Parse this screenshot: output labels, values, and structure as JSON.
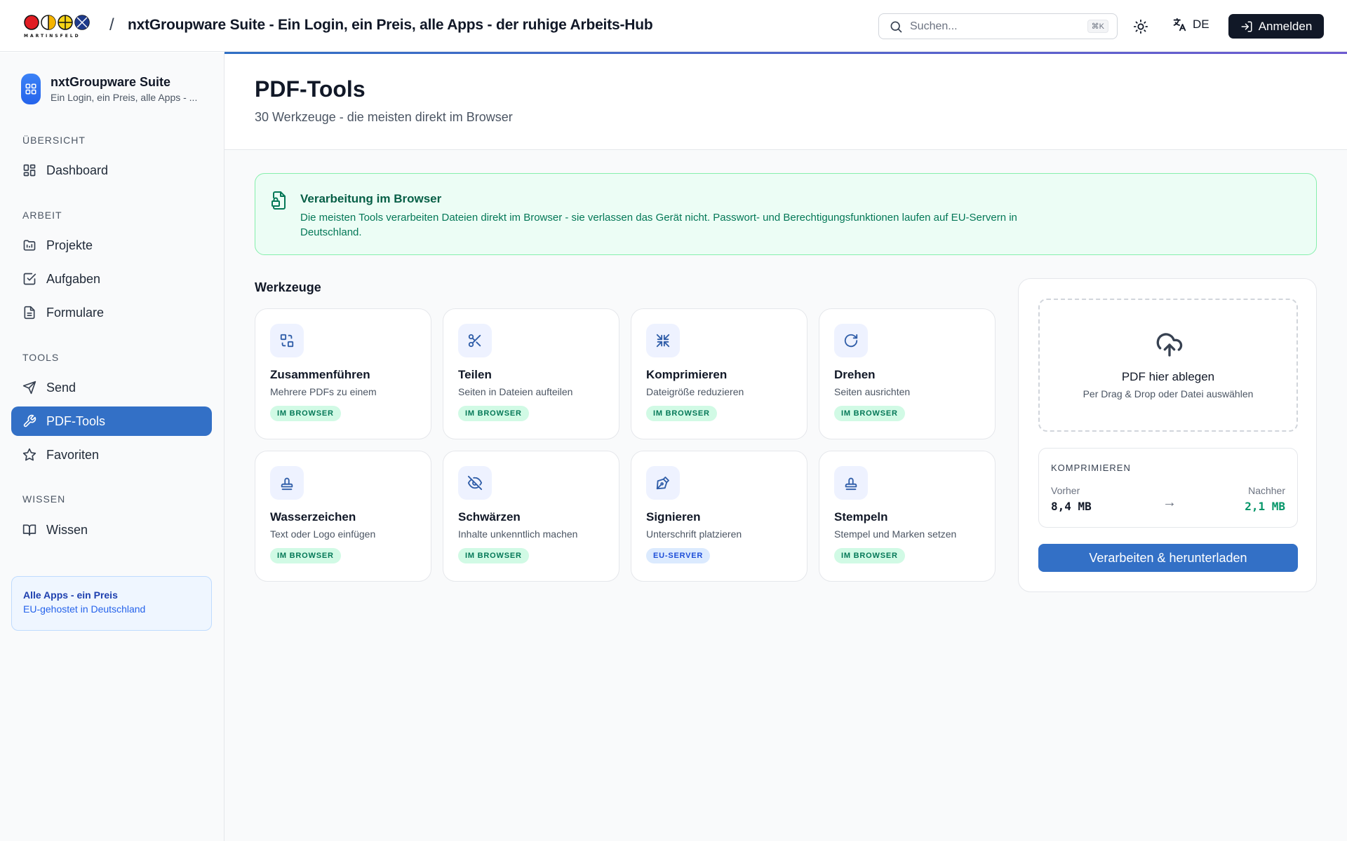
{
  "topbar": {
    "logo_text": "MARTINSFELD",
    "separator": "/",
    "title": "nxtGroupware Suite - Ein Login, ein Preis, alle Apps - der ruhige Arbeits-Hub",
    "search_placeholder": "Suchen...",
    "search_shortcut": "⌘K",
    "language": "DE",
    "login_label": "Anmelden"
  },
  "sidebar": {
    "app_name": "nxtGroupware Suite",
    "app_sub": "Ein Login, ein Preis, alle Apps - ...",
    "sections": {
      "overview": "ÜBERSICHT",
      "work": "ARBEIT",
      "tools": "TOOLS",
      "knowledge": "WISSEN"
    },
    "items": {
      "dashboard": "Dashboard",
      "projects": "Projekte",
      "tasks": "Aufgaben",
      "forms": "Formulare",
      "send": "Send",
      "pdf_tools": "PDF-Tools",
      "favorites": "Favoriten",
      "knowledge": "Wissen"
    },
    "active_item": "pdf_tools",
    "promo": {
      "title": "Alle Apps - ein Preis",
      "sub": "EU-gehostet in Deutschland"
    }
  },
  "page": {
    "title": "PDF-Tools",
    "subtitle": "30 Werkzeuge - die meisten direkt im Browser"
  },
  "notice": {
    "title": "Verarbeitung im Browser",
    "text": "Die meisten Tools verarbeiten Dateien direkt im Browser - sie verlassen das Gerät nicht. Passwort- und Berechtigungsfunktionen laufen auf EU-Servern in Deutschland."
  },
  "tools": {
    "heading": "Werkzeuge",
    "cards": [
      {
        "title": "Zusammenführen",
        "desc": "Mehrere PDFs zu einem",
        "badge": "IM BROWSER",
        "icon": "merge-icon"
      },
      {
        "title": "Teilen",
        "desc": "Seiten in Dateien aufteilen",
        "badge": "IM BROWSER",
        "icon": "scissors-icon"
      },
      {
        "title": "Komprimieren",
        "desc": "Dateigröße reduzieren",
        "badge": "IM BROWSER",
        "icon": "compress-icon"
      },
      {
        "title": "Drehen",
        "desc": "Seiten ausrichten",
        "badge": "IM BROWSER",
        "icon": "rotate-icon"
      },
      {
        "title": "Wasserzeichen",
        "desc": "Text oder Logo einfügen",
        "badge": "IM BROWSER",
        "icon": "stamp-icon"
      },
      {
        "title": "Schwärzen",
        "desc": "Inhalte unkenntlich machen",
        "badge": "IM BROWSER",
        "icon": "eye-off-icon"
      },
      {
        "title": "Signieren",
        "desc": "Unterschrift platzieren",
        "badge": "EU-SERVER",
        "icon": "pen-icon"
      },
      {
        "title": "Stempeln",
        "desc": "Stempel und Marken setzen",
        "badge": "IM BROWSER",
        "icon": "stamp-icon"
      }
    ]
  },
  "panel": {
    "drop_title": "PDF hier ablegen",
    "drop_sub": "Per Drag & Drop oder Datei auswählen",
    "compress_label": "KOMPRIMIEREN",
    "before_label": "Vorher",
    "before_value": "8,4 MB",
    "arrow": "→",
    "after_label": "Nachher",
    "after_value": "2,1 MB",
    "process_label": "Verarbeiten & herunterladen"
  },
  "colors": {
    "accent": "#3370c6",
    "success_bg": "#ecfdf5",
    "success_text": "#047857",
    "dark_button": "#111827"
  }
}
